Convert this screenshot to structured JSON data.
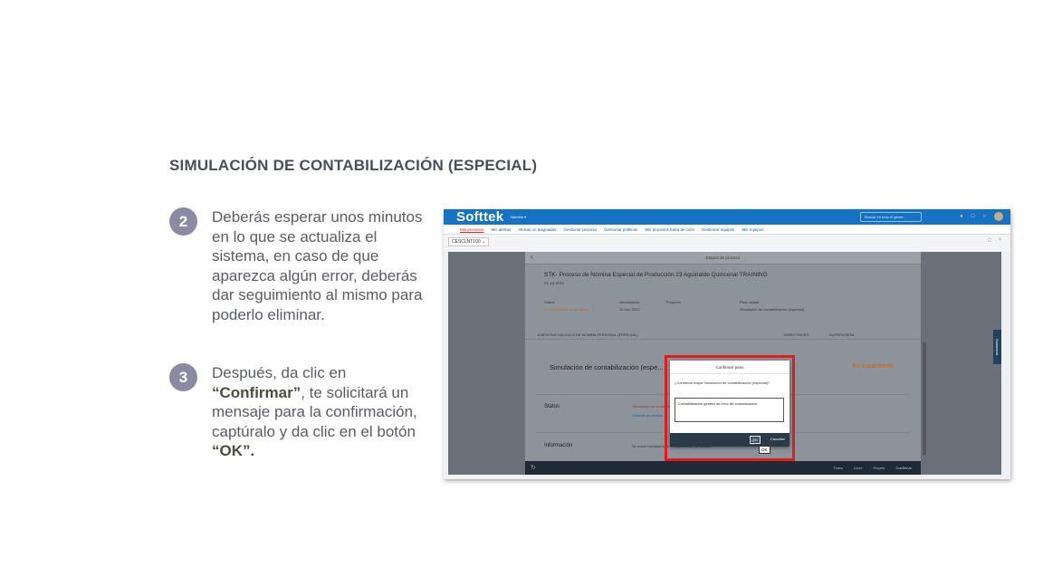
{
  "slide": {
    "title": "SIMULACIÓN DE CONTABILIZACIÓN (ESPECIAL)"
  },
  "steps": [
    {
      "number": "2",
      "text": "Deberás esperar unos minutos en lo que se actualiza el sistema, en caso de que aparezca algún error, deberás dar seguimiento al mismo para poderlo eliminar."
    },
    {
      "number": "3",
      "pre": "Después, da clic en ",
      "bold1": "“Confirmar”",
      "mid": ", te solicitará un mensaje para la confirmación, captúralo y da clic en  el botón ",
      "bold2": "“OK”."
    }
  ],
  "screenshot": {
    "brand": "Softtek",
    "brand_menu": "Nómina ▾",
    "search_placeholder": "Buscar en todo el gener...",
    "nav": [
      "Mis procesos",
      "Mis alertas",
      "Alertas no asignadas",
      "Gestionar proceso",
      "Gestionar políticas",
      "Mis procesos fuera de ciclo",
      "Gestionar equipos",
      "Mis equipos"
    ],
    "process_selector": "CESCLNT100 ⌄",
    "panel_title": "Etapas de proceso",
    "process_title": "STK- Proceso de Nómina Especial de Producción 23 Aguinaldo Quincenal TRAINING",
    "process_sub": "01.13.2011",
    "meta_labels": [
      "Status",
      "Vencimiento",
      "Progreso",
      "Paso actual"
    ],
    "meta_values": [
      "En tratamiento: en progreso",
      "30 nov. 2022",
      "",
      "Simulación de contabilización (especial)"
    ],
    "tab_left": "EJECUTAR CÁLCULO DE NÓMINA PERSONAL (ESPECIAL)",
    "tab_right_1": "DIRECTRICES",
    "tab_right_2": "SUPERVISIÓN",
    "sim_label": "Simulación de contabilización (espe...",
    "sim_status": "En tratamiento",
    "status_label": "Status",
    "status_error": "Simulación de contabilización: consulte el mensaje de error",
    "status_link": "Historial de estatus",
    "info_label": "Información",
    "info_value": "Se crean resultados de contabilización simulados",
    "side_tab": "Asistencia",
    "footer_buttons": [
      "Todos",
      "Inicio",
      "Repetir",
      "Confirmar"
    ],
    "dialog": {
      "title": "Confirmar paso",
      "question": "¿Confirmar etapa Simulación de contabilización (especial)?",
      "input_value": "Contabilización genera un error de comunicación",
      "ok": "OK",
      "cancel": "Cancelar",
      "tooltip": "OK"
    }
  }
}
